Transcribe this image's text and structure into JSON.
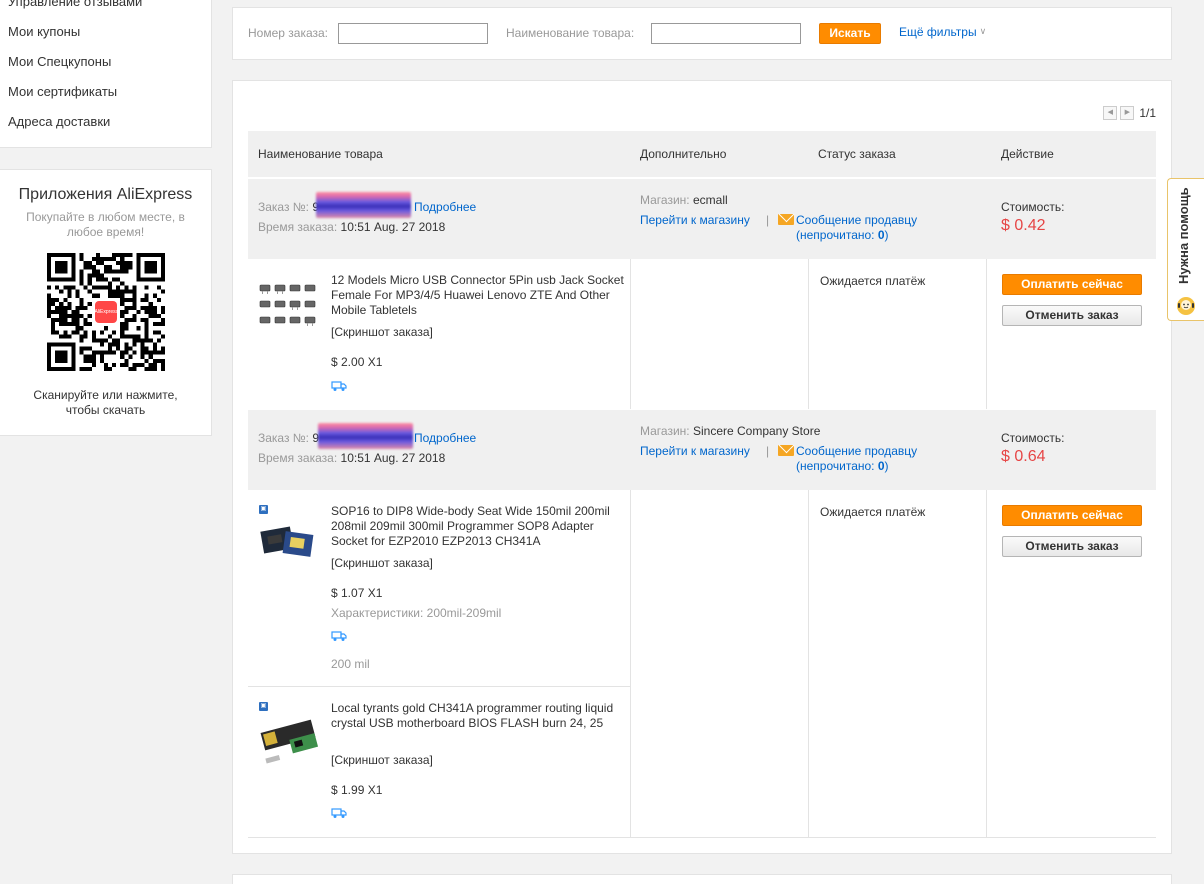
{
  "sidebar": {
    "items": [
      {
        "label": "Управление отзывами"
      },
      {
        "label": "Мои купоны"
      },
      {
        "label": "Мои Спецкупоны"
      },
      {
        "label": "Мои сертификаты"
      },
      {
        "label": "Адреса доставки"
      }
    ],
    "app": {
      "title": "Приложения AliExpress",
      "subtitle": "Покупайте в любом месте, в любое время!",
      "qr_logo": "AliExpress",
      "scan_text": "Сканируйте или нажмите, чтобы скачать"
    }
  },
  "filters": {
    "order_number_label": "Номер заказа:",
    "order_number_value": "",
    "product_name_label": "Наименование товара:",
    "product_name_value": "",
    "search_button": "Искать",
    "more_filters": "Ещё фильтры"
  },
  "pagination": {
    "page": "1/1"
  },
  "table_headers": {
    "product": "Наименование товара",
    "extra": "Дополнительно",
    "status": "Статус заказа",
    "action": "Действие"
  },
  "labels": {
    "order_no": "Заказ №:",
    "order_time": "Время заказа:",
    "details": "Подробнее",
    "store": "Магазин:",
    "go_to_store": "Перейти к магазину",
    "separator": "|",
    "message_seller": "Сообщение продавцу",
    "unread_prefix": "(непрочитано:",
    "unread_count": "0",
    "unread_suffix": ")",
    "cost": "Стоимость:",
    "pay_now": "Оплатить сейчас",
    "cancel_order": "Отменить заказ",
    "snapshot": "[Скриншот заказа]"
  },
  "orders": [
    {
      "order_number_visible": "9",
      "time": "10:51 Aug. 27 2018",
      "store": "ecmall",
      "cost": "$ 0.42",
      "status": "Ожидается платёж",
      "items": [
        {
          "title": "12 Models Micro USB Connector 5Pin usb Jack Socket Female For MP3/4/5 Huawei Lenovo ZTE And Other Mobile Tabletels",
          "price": "$ 2.00 X1"
        }
      ]
    },
    {
      "order_number_visible": "93",
      "time": "10:51 Aug. 27 2018",
      "store": "Sincere Company Store",
      "cost": "$ 0.64",
      "status": "Ожидается платёж",
      "items": [
        {
          "title": "SOP16 to DIP8 Wide-body Seat Wide 150mil 200mil 208mil 209mil 300mil Programmer SOP8 Adapter Socket for EZP2010 EZP2013 CH341A",
          "price": "$ 1.07 X1",
          "attributes": "Характеристики: 200mil-209mil",
          "extra": "200 mil"
        },
        {
          "title": "Local tyrants gold CH341A programmer routing liquid crystal USB motherboard BIOS FLASH burn 24, 25",
          "price": "$ 1.99 X1"
        }
      ]
    }
  ],
  "help_tab": {
    "label": "Нужна помощь"
  },
  "colors": {
    "accent_orange": "#ff8c00",
    "link_blue": "#0066cc",
    "price_red": "#e64545",
    "header_gray": "#f0f0f0"
  }
}
